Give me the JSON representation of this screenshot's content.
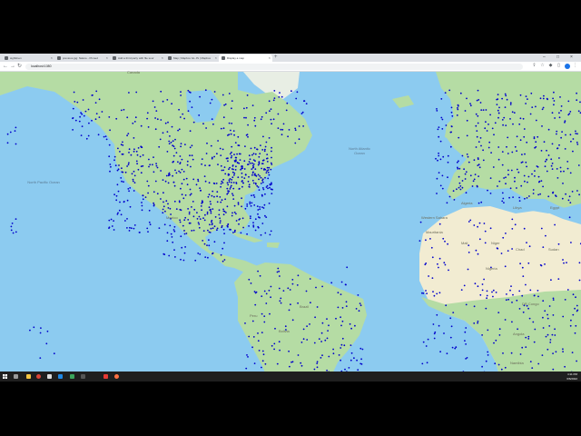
{
  "browser": {
    "tabs": [
      {
        "label": "sightlinen"
      },
      {
        "label": "previous.jpg: Nature - Pinned"
      },
      {
        "label": "Add a third party with file sour"
      },
      {
        "label": "Map | Mapbox GL JS | Mapbox"
      },
      {
        "label": "Display a map"
      }
    ],
    "new_tab_label": "+",
    "url": "localhost:1080",
    "window_controls": [
      "–",
      "□",
      "×"
    ]
  },
  "map": {
    "labels": {
      "canada": "Canada",
      "north_atlantic": "North Atlantic Ocean",
      "north_pacific": "North Pacific Ocean",
      "western_sahara": "Western Sahara",
      "mauritania": "Mauritania",
      "mali": "Mali",
      "niger": "Niger",
      "chad": "Chad",
      "sudan": "Sudan",
      "libya": "Libya",
      "egypt": "Egypt",
      "algeria": "Algeria",
      "nigeria": "Nigeria",
      "dr_congo": "DR Congo",
      "angola": "Angola",
      "namibia": "Namibia",
      "mexico": "Mexico",
      "brazil": "Brazil",
      "peru": "Peru",
      "bolivia": "Bolivia"
    },
    "attribution": "© MapTiler © OpenStreetMap contributors",
    "colors": {
      "ocean": "#8ccbf0",
      "land_green": "#b5dca4",
      "land_desert": "#f2ecd2",
      "points": "#0000cc"
    }
  },
  "taskbar": {
    "time": "4:11 PM",
    "date": "6/6/2022"
  }
}
